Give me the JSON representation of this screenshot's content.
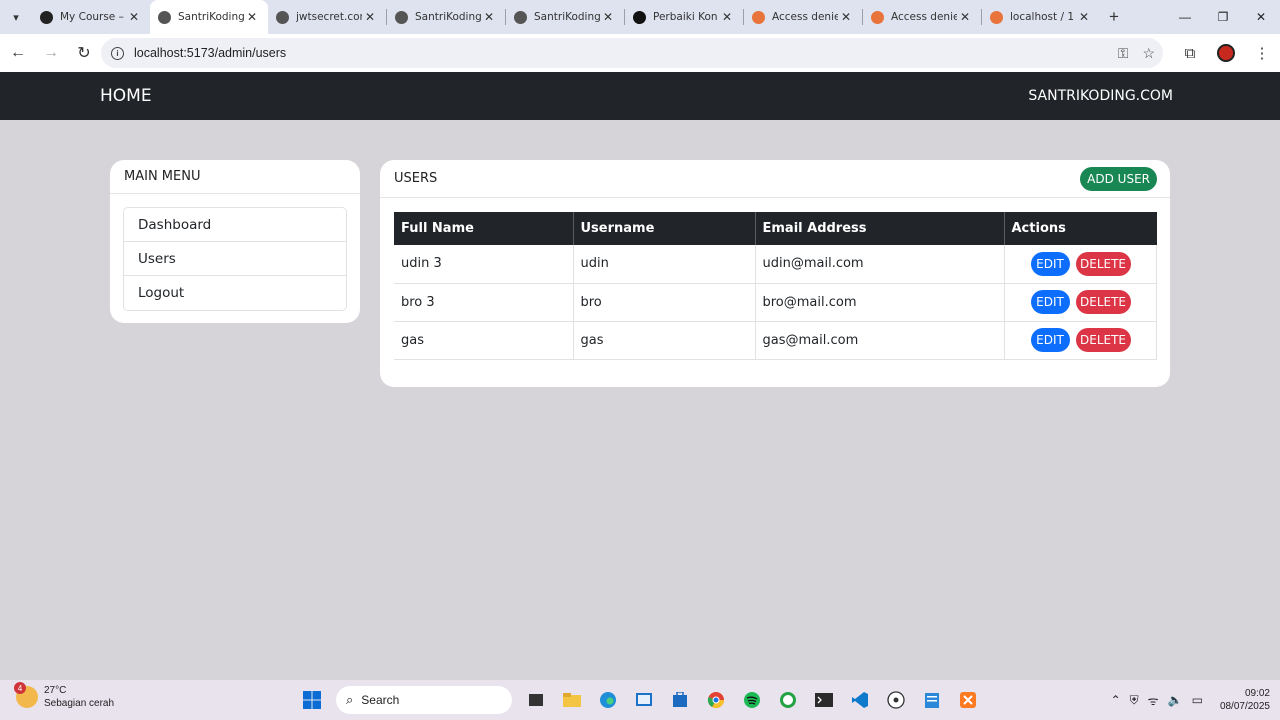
{
  "browser": {
    "tabs": [
      {
        "title": "My Course –",
        "active": false,
        "favicon": "github-icon",
        "color": "#222222"
      },
      {
        "title": "SantriKoding",
        "active": true,
        "favicon": "globe-icon",
        "color": "#555555"
      },
      {
        "title": "jwtsecret.com",
        "active": false,
        "favicon": "globe-icon",
        "color": "#555555"
      },
      {
        "title": "SantriKoding",
        "active": false,
        "favicon": "globe-icon",
        "color": "#555555"
      },
      {
        "title": "SantriKoding",
        "active": false,
        "favicon": "globe-icon",
        "color": "#555555"
      },
      {
        "title": "Perbaiki Kon",
        "active": false,
        "favicon": "openai-icon",
        "color": "#111111"
      },
      {
        "title": "Access denie",
        "active": false,
        "favicon": "xampp-icon",
        "color": "#e8743b"
      },
      {
        "title": "Access denie",
        "active": false,
        "favicon": "xampp-icon",
        "color": "#e8743b"
      },
      {
        "title": "localhost / 1",
        "active": false,
        "favicon": "phpmyadmin-icon",
        "color": "#e8743b"
      }
    ],
    "url": "localhost:5173/admin/users"
  },
  "navbar": {
    "brand": "HOME",
    "right_link": "SANTRIKODING.COM"
  },
  "sidebar": {
    "title": "MAIN MENU",
    "items": [
      {
        "label": "Dashboard"
      },
      {
        "label": "Users"
      },
      {
        "label": "Logout"
      }
    ]
  },
  "users": {
    "title": "USERS",
    "add_label": "ADD USER",
    "columns": [
      "Full Name",
      "Username",
      "Email Address",
      "Actions"
    ],
    "rows": [
      {
        "full_name": "udin 3",
        "username": "udin",
        "email": "udin@mail.com"
      },
      {
        "full_name": "bro 3",
        "username": "bro",
        "email": "bro@mail.com"
      },
      {
        "full_name": "gas",
        "username": "gas",
        "email": "gas@mail.com"
      }
    ],
    "edit_label": "EDIT",
    "delete_label": "DELETE"
  },
  "taskbar": {
    "weather_temp": "27°C",
    "weather_desc": "Sebagian cerah",
    "weather_badge": "4",
    "search_label": "Search",
    "time": "09:02",
    "date": "08/07/2025"
  },
  "colors": {
    "navbar_bg": "#212529",
    "add_button": "#198754",
    "edit_button": "#0d6efd",
    "delete_button": "#dc3545",
    "page_bg": "#d6d4d8"
  }
}
